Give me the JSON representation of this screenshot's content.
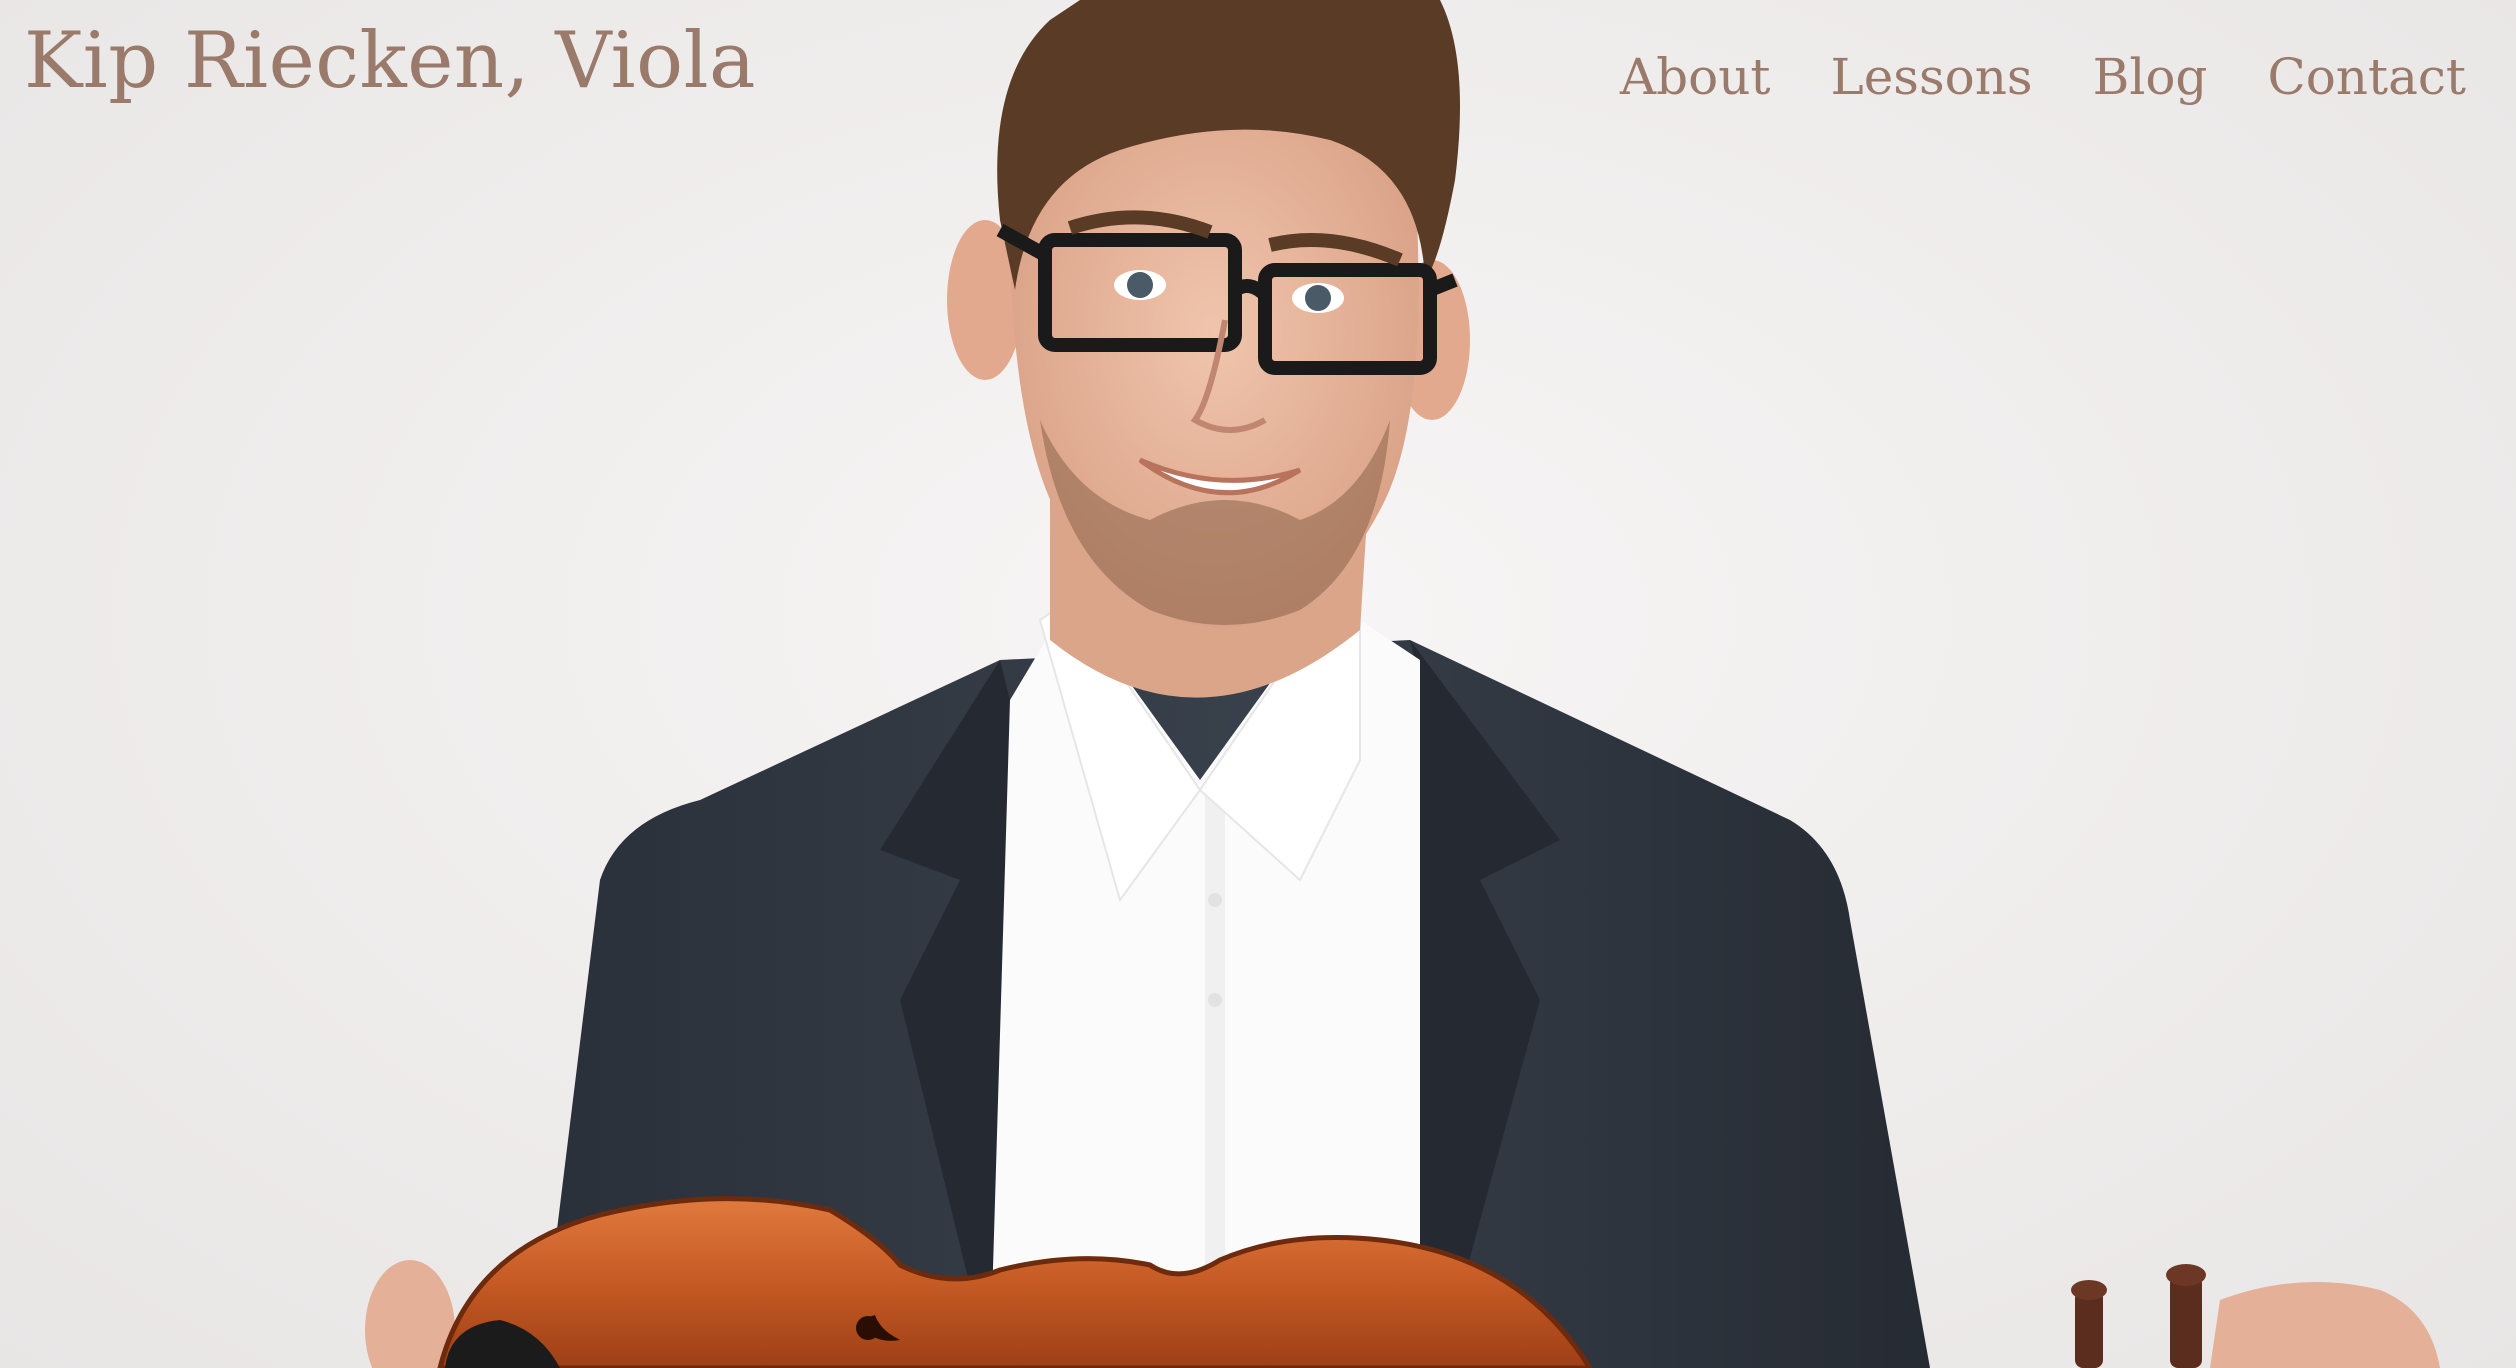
{
  "site": {
    "title": "Kip Riecken, Viola"
  },
  "nav": {
    "items": [
      {
        "label": "About"
      },
      {
        "label": "Lessons"
      },
      {
        "label": "Blog"
      },
      {
        "label": "Contact"
      }
    ]
  },
  "colors": {
    "accent": "#9a7a6a",
    "background": "#efeded",
    "jacket": "#2f3640",
    "shirt": "#fafafa",
    "viola": "#c85a26",
    "skin": "#e6b39a",
    "hair": "#5a3a24"
  }
}
